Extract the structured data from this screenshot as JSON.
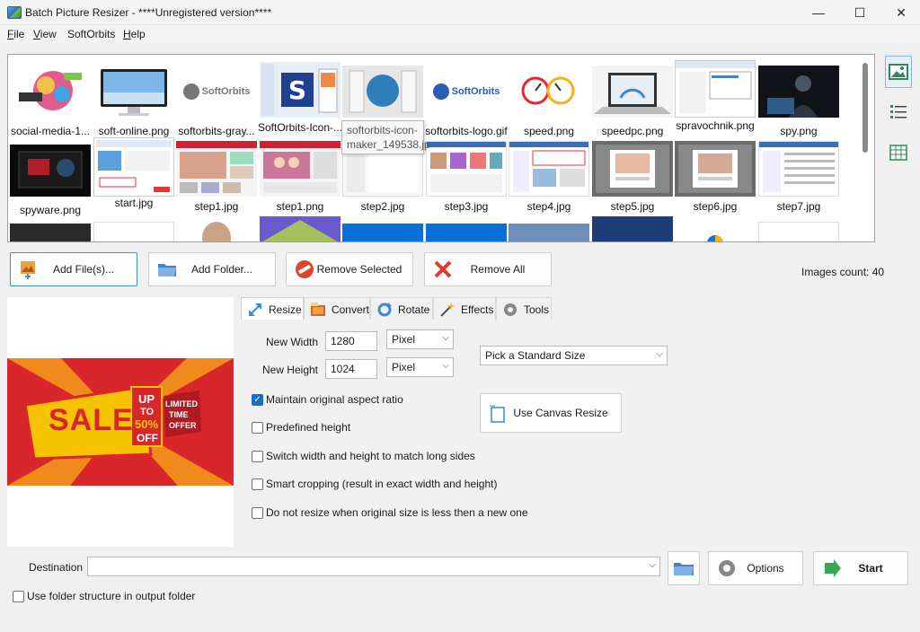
{
  "window": {
    "title": "Batch Picture Resizer - ****Unregistered version****",
    "min_glyph": "—",
    "max_glyph": "☐",
    "close_glyph": "✕"
  },
  "menu": [
    {
      "label": "File",
      "underline": "F",
      "rest": "ile"
    },
    {
      "label": "View",
      "underline": "V",
      "rest": "iew"
    },
    {
      "label": "SoftOrbits",
      "underline": "",
      "rest": "SoftOrbits"
    },
    {
      "label": "Help",
      "underline": "H",
      "rest": "elp"
    }
  ],
  "thumbnails": {
    "row1": [
      "social-media-1...",
      "soft-online.png",
      "softorbits-gray...",
      "SoftOrbits-Icon-...",
      "",
      "softorbits-logo.gif",
      "speed.png",
      "speedpc.png",
      "spravochnik.png",
      "spy.png"
    ],
    "row2": [
      "spyware.png",
      "start.jpg",
      "step1.jpg",
      "step1.png",
      "step2.jpg",
      "step3.jpg",
      "step4.jpg",
      "step5.jpg",
      "step6.jpg",
      "step7.jpg"
    ],
    "logo_text": "SoftOrbits",
    "tooltip": "softorbits-icon-maker_149538.jp"
  },
  "buttons": {
    "add_files": "Add File(s)...",
    "add_folder": "Add Folder...",
    "remove_selected": "Remove Selected",
    "remove_all": "Remove All"
  },
  "images_count": "Images count: 40",
  "preview": {
    "sale_text": "SALE",
    "up_to": "UP",
    "to": "TO",
    "percent": "50%",
    "off": "OFF",
    "limited": "LIMITED",
    "time": "TIME",
    "offer": "OFFER"
  },
  "tabs": [
    "Resize",
    "Convert",
    "Rotate",
    "Effects",
    "Tools"
  ],
  "resize": {
    "new_width_label": "New Width",
    "new_width_value": "1280",
    "new_height_label": "New Height",
    "new_height_value": "1024",
    "width_unit": "Pixel",
    "height_unit": "Pixel",
    "standard_size": "Pick a Standard Size",
    "maintain_aspect": "Maintain original aspect ratio",
    "maintain_aspect_checked": true,
    "predefined_height": "Predefined height",
    "switch_wh": "Switch width and height to match long sides",
    "smart_crop": "Smart cropping (result in exact width and height)",
    "no_resize_smaller": "Do not resize when original size is less then a new one",
    "canvas_resize": "Use Canvas Resize"
  },
  "bottom": {
    "destination_label": "Destination",
    "destination_value": "",
    "options": "Options",
    "start": "Start",
    "folder_structure": "Use folder structure in output folder"
  },
  "colors": {
    "accent": "#1a6fc4",
    "sale_red": "#d8262b",
    "sale_yellow": "#f7c200"
  }
}
